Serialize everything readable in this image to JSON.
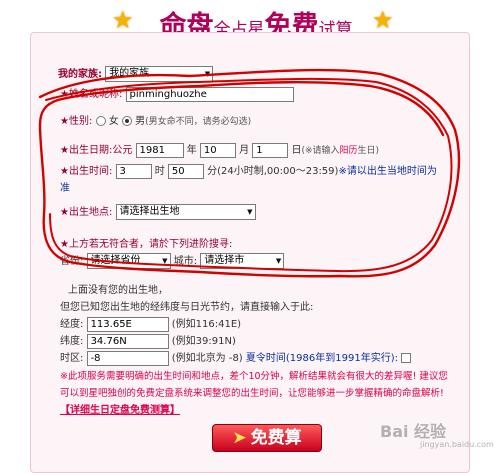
{
  "header": {
    "title_big1": "命盘",
    "title_small1": "全占星",
    "title_big2": "免费",
    "title_small2": "试算"
  },
  "form": {
    "family_label": "我的家族:",
    "family_value": "我的家族",
    "name_label": "姓名或昵称:",
    "name_value": "pinminghuozhe",
    "gender_label": "性别:",
    "gender_female": "女",
    "gender_male": "男",
    "gender_note": "(男女命不同，请务必勾选)",
    "birth_date_label": "出生日期:公元",
    "year_value": "1981",
    "year_unit": "年",
    "month_value": "10",
    "month_unit": "月",
    "day_value": "1",
    "day_unit": "日",
    "date_note_prefix": "(※请输入",
    "date_note_highlight": "阳历",
    "date_note_suffix": "生日)",
    "birth_time_label": "出生时间:",
    "hour_value": "3",
    "hour_unit": "时",
    "minute_value": "50",
    "minute_unit": "分(24小时制,00:00～23:59)",
    "time_note_line1": "※请以出生当地时间为",
    "time_note_line2": "准",
    "birthplace_label": "出生地点:",
    "birthplace_value": "请选择出生地",
    "search_hint": "上方若无符合者，请於下列进阶搜寻:",
    "province_label": "省份:",
    "province_value": "请选择省份",
    "city_label": "城市:",
    "city_value": "请选择市",
    "no_place": "上面没有您的出生地，",
    "manual_hint": "但您已知您出生地的经纬度与日光节约，请直接输入于此:",
    "longitude_label": "经度:",
    "longitude_value": "113.65E",
    "longitude_example": "(例如116:41E)",
    "latitude_label": "纬度:",
    "latitude_value": "34.76N",
    "latitude_example": "(例如39:91N)",
    "timezone_label": "时区:",
    "timezone_value": "-8",
    "timezone_example": "(例如北京为 -8)",
    "dst_label": "夏令时间(1986年到1991年实行):",
    "notice_line1": "※此项服务需要明确的出生时间和地点，差个10分钟，解析结果就会有很大的差异喔! 建议您",
    "notice_line2": "可以到星吧独创的免费定盘系统来调整您的出生时间，让您能够进一步掌握精确的命盘解析!",
    "detail_link": "【详细生日定盘免费测算】",
    "submit_label": "免费算",
    "submit_arrow": "➤"
  },
  "watermark": {
    "main": "Bai 经验",
    "sub": "jingyan.baidu.com"
  },
  "colors": {
    "title": "#b0005a",
    "label": "#9b0032",
    "highlight": "#e0004e",
    "annotation": "#d40000",
    "button": "#c8001e"
  }
}
